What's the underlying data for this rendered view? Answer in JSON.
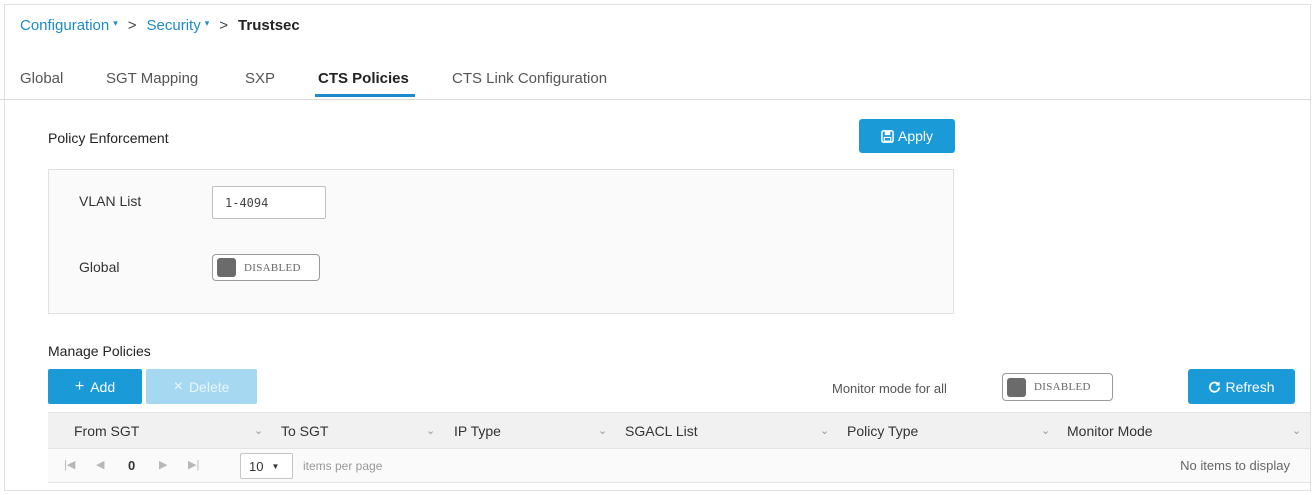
{
  "breadcrumb": {
    "configuration": "Configuration",
    "security": "Security",
    "current": "Trustsec",
    "separator": ">",
    "caret": "▾"
  },
  "tabs": [
    {
      "label": "Global"
    },
    {
      "label": "SGT Mapping"
    },
    {
      "label": "SXP"
    },
    {
      "label": "CTS Policies"
    },
    {
      "label": "CTS Link Configuration"
    }
  ],
  "active_tab": "CTS Policies",
  "policy_enforcement": {
    "title": "Policy Enforcement",
    "apply_label": "Apply",
    "vlan_list_label": "VLAN List",
    "vlan_list_value": "1-4094",
    "global_label": "Global",
    "global_toggle": "DISABLED"
  },
  "manage_policies": {
    "title": "Manage Policies",
    "add_label": "Add",
    "delete_label": "Delete",
    "monitor_mode_all_label": "Monitor mode for all",
    "monitor_mode_all_toggle": "DISABLED",
    "refresh_label": "Refresh",
    "columns": [
      "From SGT",
      "To SGT",
      "IP Type",
      "SGACL List",
      "Policy Type",
      "Monitor Mode"
    ],
    "pager": {
      "page": "0",
      "per_page": "10",
      "per_page_label": "items per page",
      "empty_text": "No items to display"
    }
  },
  "icons": {
    "add": "plus-icon",
    "delete": "close-icon",
    "apply": "save-icon",
    "refresh": "refresh-icon"
  },
  "colors": {
    "accent": "#1b9ad8",
    "link": "#1b8bc9",
    "disabled_button": "#a6d8f1"
  }
}
